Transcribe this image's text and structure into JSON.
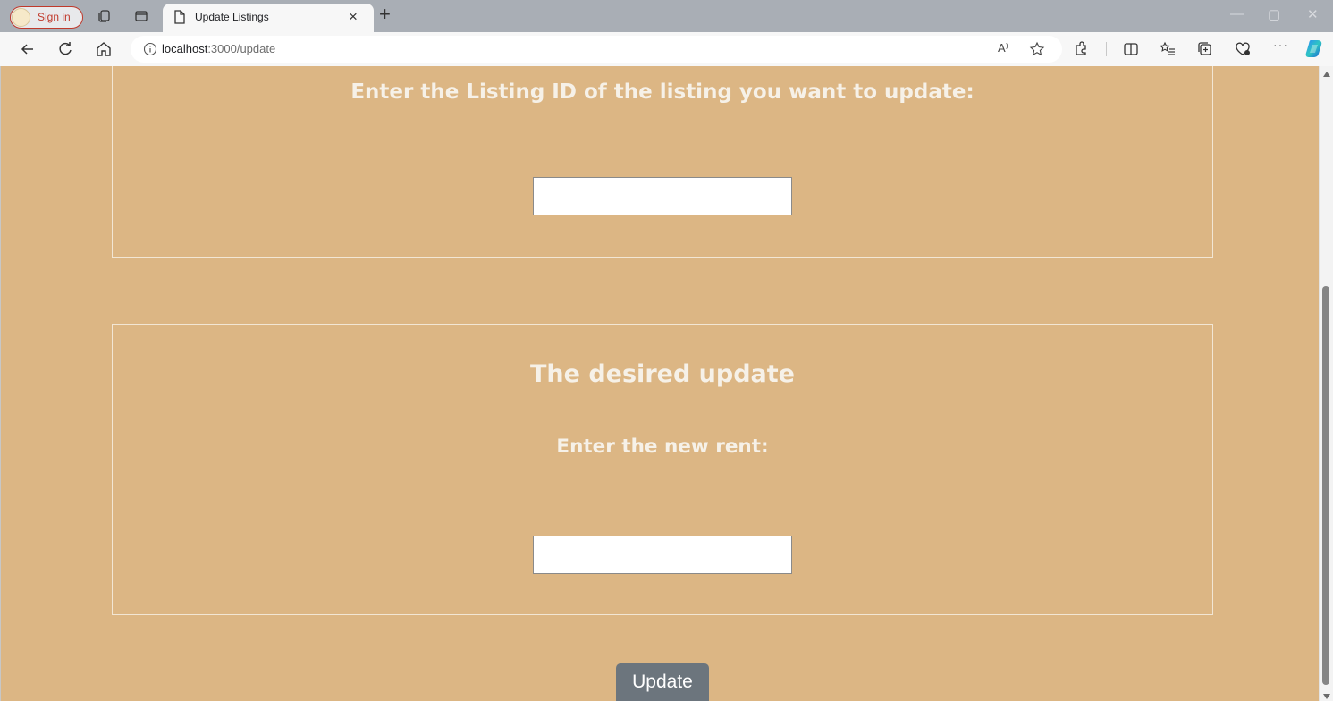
{
  "browser": {
    "profile_label": "Sign in",
    "tab_title": "Update Listings",
    "tab_close": "×",
    "new_tab": "+",
    "url_host": "localhost",
    "url_path": ":3000/update",
    "read_aloud": "A⁾",
    "more": "···",
    "win_min": "—",
    "win_max": "▢",
    "win_close": "✕"
  },
  "page": {
    "listing_prompt": "Enter the Listing ID of the listing you want to update:",
    "listing_input_value": "",
    "update_section_title": "The desired update",
    "rent_prompt": "Enter the new rent:",
    "rent_input_value": "",
    "update_button": "Update",
    "background_color": "#dcb684",
    "button_color": "#6c757d"
  }
}
